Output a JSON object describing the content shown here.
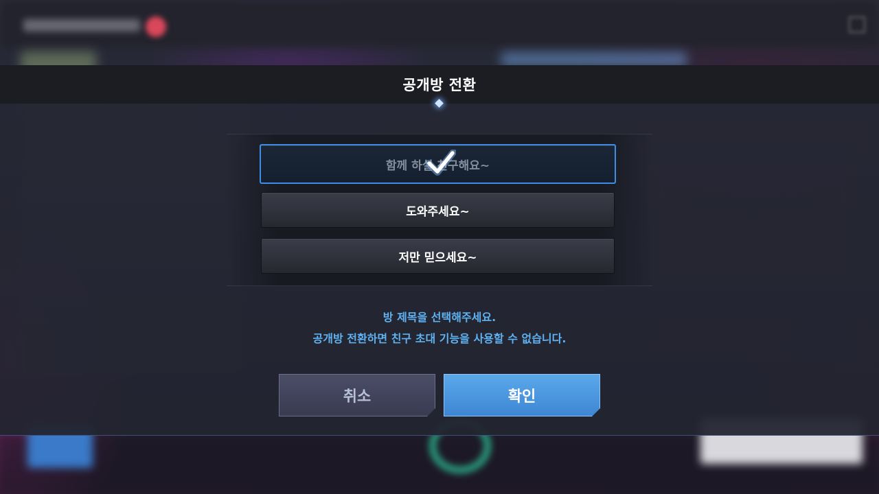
{
  "dialog": {
    "title": "공개방 전환"
  },
  "options": [
    {
      "label": "함께 하실 친구해요~",
      "selected": true
    },
    {
      "label": "도와주세요~",
      "selected": false
    },
    {
      "label": "저만 믿으세요~",
      "selected": false
    }
  ],
  "messages": {
    "line1": "방 제목을 선택해주세요.",
    "line2": "공개방 전환하면 친구 초대 기능을 사용할 수 없습니다."
  },
  "buttons": {
    "cancel_label": "취소",
    "confirm_label": "확인"
  },
  "colors": {
    "accent": "#3d8ee6",
    "message_text": "#5fb3f2",
    "confirm_button": "#4a96de"
  },
  "icons": {
    "selection": "checkmark-icon"
  }
}
